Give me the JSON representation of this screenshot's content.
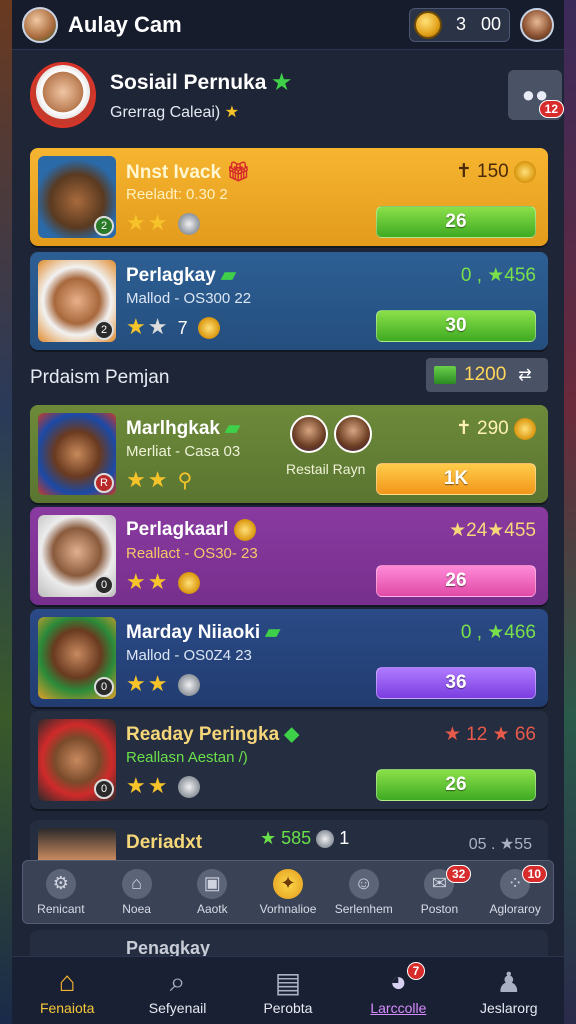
{
  "header": {
    "title": "Aulay Cam",
    "coins_a": "3",
    "coins_b": "00"
  },
  "profile": {
    "name": "Sosiail Pernuka",
    "subtitle": "Grerrag Caleai)",
    "chat_badge": "12"
  },
  "cards_top": [
    {
      "name": "Nnst Ivack",
      "sub": "Reeladt: 0.30 2",
      "level": "2",
      "score": "✝ 150",
      "button": "26"
    },
    {
      "name": "Perlagkay",
      "sub": "Mallod - OS300 22",
      "level": "2",
      "score": "0 , ★456",
      "stars_extra": "7",
      "button": "30"
    }
  ],
  "section": {
    "title": "Prdaism Pemjan",
    "badge_value": "1200"
  },
  "cards_bottom": [
    {
      "name": "Marlhgkak",
      "sub": "Merliat - Casa 03",
      "level": "R",
      "score": "✝ 290",
      "button": "1K",
      "mini_label": "Restail Rayn"
    },
    {
      "name": "Perlagkaarl",
      "sub": "Reallact - OS30- 23",
      "level": "0",
      "score": "★24★455",
      "button": "26"
    },
    {
      "name": "Marday Niiaoki",
      "sub": "Mallod - OS0Z4 23",
      "level": "0",
      "score": "0 , ★466",
      "button": "36"
    },
    {
      "name": "Readay Peringka",
      "sub": "Reallasn Aestan /)",
      "level": "0",
      "score": "★ 12 ★ 66",
      "button": "26"
    }
  ],
  "partial_card": {
    "name": "Deriadxt",
    "mid": "★ 585",
    "mid_extra": "1",
    "right": "05 . ★55"
  },
  "partial_card2": {
    "name": "Penagkay"
  },
  "tools": [
    {
      "label": "Renicant",
      "icon": "gear-icon"
    },
    {
      "label": "Noea",
      "icon": "home-icon"
    },
    {
      "label": "Aaotk",
      "icon": "bag-icon"
    },
    {
      "label": "Vorhnalioe",
      "icon": "compass-icon"
    },
    {
      "label": "Serlenhem",
      "icon": "person-icon"
    },
    {
      "label": "Poston",
      "icon": "mail-icon",
      "badge": "32"
    },
    {
      "label": "Agloraroy",
      "icon": "dots-icon",
      "badge": "10"
    }
  ],
  "nav": [
    {
      "label": "Fenaiota",
      "icon": "home-icon"
    },
    {
      "label": "Sefyenail",
      "icon": "search-icon"
    },
    {
      "label": "Perobta",
      "icon": "map-icon"
    },
    {
      "label": "Larccolle",
      "icon": "chat-icon",
      "badge": "7"
    },
    {
      "label": "Jeslarorg",
      "icon": "profile-icon"
    }
  ]
}
